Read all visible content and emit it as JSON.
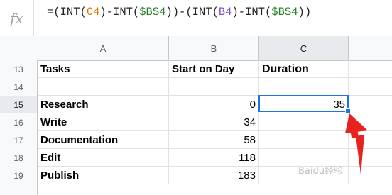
{
  "formula_bar": {
    "fx_label": "fx",
    "formula_parts": [
      {
        "text": "=(INT(",
        "kind": "plain"
      },
      {
        "text": "C4",
        "kind": "ref-c"
      },
      {
        "text": ")-INT(",
        "kind": "plain"
      },
      {
        "text": "$B$4",
        "kind": "ref-abs"
      },
      {
        "text": "))-(INT(",
        "kind": "plain"
      },
      {
        "text": "B4",
        "kind": "ref-b"
      },
      {
        "text": ")-INT(",
        "kind": "plain"
      },
      {
        "text": "$B$4",
        "kind": "ref-abs"
      },
      {
        "text": "))",
        "kind": "plain"
      }
    ]
  },
  "columns": [
    {
      "label": "A",
      "active": false
    },
    {
      "label": "B",
      "active": false
    },
    {
      "label": "C",
      "active": true
    }
  ],
  "rows": [
    {
      "num": "13",
      "a": "Tasks",
      "b": "Start on Day",
      "c": "Duration",
      "header": true
    },
    {
      "num": "14",
      "a": "",
      "b": "",
      "c": ""
    },
    {
      "num": "15",
      "a": "Research",
      "b": "0",
      "c": "35",
      "active": true
    },
    {
      "num": "16",
      "a": "Write",
      "b": "34",
      "c": ""
    },
    {
      "num": "17",
      "a": "Documentation",
      "b": "58",
      "c": ""
    },
    {
      "num": "18",
      "a": "Edit",
      "b": "118",
      "c": ""
    },
    {
      "num": "19",
      "a": "Publish",
      "b": "183",
      "c": ""
    }
  ],
  "annotation": {
    "arrow_color": "#e8231f",
    "icon": "red-arrow-icon"
  },
  "watermark": "Baidu经验"
}
